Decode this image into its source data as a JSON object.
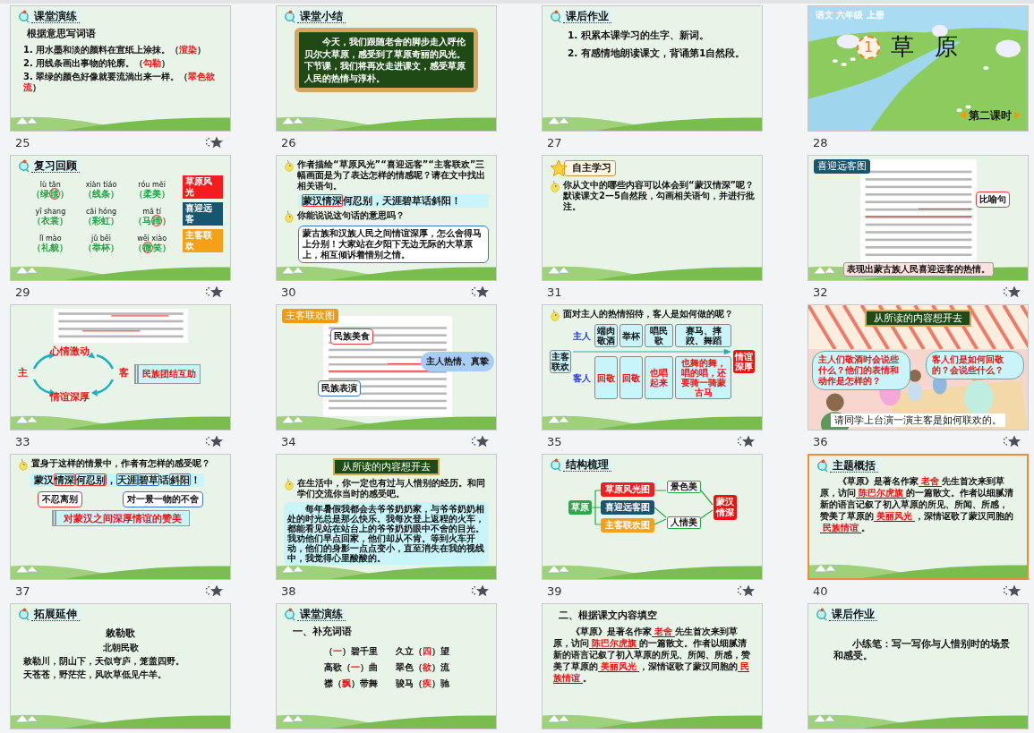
{
  "slides": [
    {
      "number": "25",
      "selected": false,
      "transition": true,
      "kind": "text",
      "blocks": [
        {
          "kind": "heading",
          "text": "课堂演练"
        },
        {
          "kind": "subtitle",
          "text": "根据意思写词语"
        },
        {
          "kind": "line",
          "segments": [
            {
              "text": "1. 用水墨和淡的颜料在宣纸上涂抹。（",
              "answer": false
            },
            {
              "text": "渲染",
              "answer": true
            },
            {
              "text": "）",
              "answer": false
            }
          ]
        },
        {
          "kind": "line",
          "segments": [
            {
              "text": "2. 用线条画出事物的轮廓。（",
              "answer": false
            },
            {
              "text": "勾勒",
              "answer": true
            },
            {
              "text": "）",
              "answer": false
            }
          ]
        },
        {
          "kind": "line",
          "segments": [
            {
              "text": "3. 翠绿的颜色好像就要流淌出来一样。（",
              "answer": false
            },
            {
              "text": "翠色欲流",
              "answer": true
            },
            {
              "text": "）",
              "answer": false
            }
          ]
        }
      ]
    },
    {
      "number": "26",
      "selected": false,
      "transition": false,
      "kind": "text",
      "blocks": [
        {
          "kind": "heading",
          "text": "课堂小结"
        },
        {
          "kind": "board",
          "text": "今天，我们跟随老舍的脚步走入呼伦贝尔大草原，感受到了草原奇丽的风光。下节课，我们将再次走进课文，感受草原人民的热情与淳朴。"
        }
      ]
    },
    {
      "number": "27",
      "selected": false,
      "transition": false,
      "kind": "text",
      "blocks": [
        {
          "kind": "heading",
          "text": "课后作业"
        },
        {
          "kind": "item",
          "text": "1. 积累本课学习的生字、新词。"
        },
        {
          "kind": "item",
          "text": "2. 有感情地朗读课文，背诵第1自然段。"
        }
      ]
    },
    {
      "number": "28",
      "selected": false,
      "transition": false,
      "kind": "title",
      "course": "语文 六年级 上册",
      "lesson_number": "1",
      "title": "草原",
      "period": "第二课时"
    },
    {
      "number": "29",
      "selected": false,
      "transition": true,
      "kind": "pinyin",
      "heading": "复习回顾",
      "rows": [
        {
          "cells": [
            {
              "pinyin": "lù tǎn",
              "word": [
                {
                  "text": "（绿",
                  "circled": false
                },
                {
                  "text": "毯",
                  "circled": true
                },
                {
                  "text": "）",
                  "circled": false
                }
              ]
            },
            {
              "pinyin": "xiàn tiáo",
              "word": [
                {
                  "text": "（线条）",
                  "circled": false
                }
              ]
            },
            {
              "pinyin": "róu měi",
              "word": [
                {
                  "text": "（柔美）",
                  "circled": false
                }
              ]
            }
          ],
          "tag": {
            "text": "草原风光",
            "color": "#f41c1c"
          }
        },
        {
          "cells": [
            {
              "pinyin": "yī shang",
              "word": [
                {
                  "text": "（衣裳）",
                  "circled": false
                }
              ]
            },
            {
              "pinyin": "cǎi hóng",
              "word": [
                {
                  "text": "（彩虹）",
                  "circled": false
                }
              ]
            },
            {
              "pinyin": "mǎ tí",
              "word": [
                {
                  "text": "（马",
                  "circled": false
                },
                {
                  "text": "蹄",
                  "circled": true
                },
                {
                  "text": "）",
                  "circled": false
                }
              ]
            }
          ],
          "tag": {
            "text": "喜迎远客",
            "color": "#17566e"
          }
        },
        {
          "cells": [
            {
              "pinyin": "lǐ mào",
              "word": [
                {
                  "text": "（礼貌）",
                  "circled": false
                }
              ]
            },
            {
              "pinyin": "jǔ bēi",
              "word": [
                {
                  "text": "（举杯）",
                  "circled": false
                }
              ]
            },
            {
              "pinyin": "wēi xiào",
              "word": [
                {
                  "text": "（",
                  "circled": false
                },
                {
                  "text": "微",
                  "circled": true
                },
                {
                  "text": "笑）",
                  "circled": false
                }
              ]
            }
          ],
          "tag": {
            "text": "主客联欢",
            "color": "#f6a019"
          }
        }
      ]
    },
    {
      "number": "30",
      "selected": false,
      "transition": true,
      "kind": "text",
      "blocks": [
        {
          "kind": "prompt",
          "text": "作者描绘“草原风光”“喜迎远客”“主客联欢”三幅画面是为了表达怎样的情感呢？请在文中找出相关语句。"
        },
        {
          "kind": "quote",
          "segments": [
            {
              "text": "蒙汉情深",
              "boxed": true
            },
            {
              "text": "何忍别，天涯碧草话斜阳！",
              "boxed": false
            }
          ]
        },
        {
          "kind": "prompt",
          "text": "你能说说这句话的意思吗？"
        },
        {
          "kind": "explanation",
          "text": "蒙古族和汉族人民之间情谊深厚，怎么舍得马上分别！大家站在夕阳下无边无际的大草原上，相互倾诉着惜别之情。"
        }
      ]
    },
    {
      "number": "31",
      "selected": false,
      "transition": false,
      "kind": "text",
      "blocks": [
        {
          "kind": "badge",
          "text": "自主学习"
        },
        {
          "kind": "prompt",
          "text": "你从文中的哪些内容可以体会到“蒙汉情深”呢？默读课文2—5自然段，勾画相关语句，并进行批注。"
        }
      ]
    },
    {
      "number": "32",
      "selected": false,
      "transition": true,
      "kind": "annotated",
      "tag": {
        "text": "喜迎远客图",
        "color": "#17566e"
      },
      "callouts": [
        {
          "text": "比喻句",
          "color": "#e53935"
        }
      ],
      "caption": "表现出蒙古族人民喜迎远客的热情。"
    },
    {
      "number": "33",
      "selected": false,
      "transition": true,
      "kind": "cycle",
      "cycle": {
        "top": "心情激动",
        "left": "主",
        "right": "客",
        "bottom": "情谊深厚"
      },
      "scroll": "民族团结互助"
    },
    {
      "number": "34",
      "selected": false,
      "transition": true,
      "kind": "annotated",
      "tag": {
        "text": "主客联欢图",
        "color": "#f39a12"
      },
      "callouts": [
        {
          "text": "民族美食",
          "color": "#e53935"
        },
        {
          "text": "民族表演",
          "color": "#3a78c2"
        }
      ],
      "cloud": "主人热情、真挚"
    },
    {
      "number": "35",
      "selected": false,
      "transition": true,
      "kind": "fishbone",
      "prompt": "面对主人的热情招待，客人是如何做的呢？",
      "start": "主客联欢",
      "end": "情谊深厚",
      "rows": [
        {
          "label": "主人",
          "items": [
            "端肉敬酒",
            "举杯",
            "唱民歌",
            "赛马、摔跤、舞蹈"
          ]
        },
        {
          "label": "客人",
          "items": [
            "回敬",
            "回敬",
            "也唱起来",
            "也舞的舞，唱的唱，还要骑一骑蒙古马"
          ]
        }
      ]
    },
    {
      "number": "36",
      "selected": false,
      "transition": true,
      "kind": "scene",
      "banner": "从所读的内容想开去",
      "clouds": [
        "主人们敬酒时会说些什么？他们的表情和动作是怎样的？",
        "客人们是如何回敬的？会说些什么？"
      ],
      "caption": "请同学上台演一演主客是如何联欢的。"
    },
    {
      "number": "37",
      "selected": false,
      "transition": true,
      "kind": "analysis",
      "prompt": "置身于这样的情景中，作者有怎样的感受呢？",
      "sentence": [
        {
          "text": "蒙汉"
        },
        {
          "text": "情深",
          "color": "#e53935"
        },
        {
          "text": "何忍别",
          "color": "#e53935"
        },
        {
          "text": "，"
        },
        {
          "text": "天涯",
          "color": "#3a78c2"
        },
        {
          "text": "碧草",
          "color": "#3a78c2"
        },
        {
          "text": "话"
        },
        {
          "text": "斜阳",
          "color": "#3a78c2"
        },
        {
          "text": "！"
        }
      ],
      "callouts": [
        {
          "text": "不忍离别",
          "color": "#e53935"
        },
        {
          "text": "对一景一物的不舍",
          "color": "#3a78c2"
        }
      ],
      "scroll": "对蒙汉之间深厚情谊的赞美"
    },
    {
      "number": "38",
      "selected": false,
      "transition": true,
      "kind": "text",
      "blocks": [
        {
          "kind": "banner",
          "text": "从所读的内容想开去"
        },
        {
          "kind": "prompt",
          "text": "在生活中，你一定也有过与人惜别的经历。和同学们交流你当时的感受吧。"
        },
        {
          "kind": "story",
          "text": "每年暑假我都会去爷爷奶奶家，与爷爷奶奶相处的时光总是那么快乐。我每次登上返程的火车，都能看见站在站台上的爷爷奶奶眼中不舍的目光。我劝他们早点回家，他们却从不肯。等到火车开动，他们的身影一点点变小，直至消失在我的视线中，我觉得心里酸酸的。"
        }
      ]
    },
    {
      "number": "39",
      "selected": false,
      "transition": true,
      "kind": "structure",
      "heading": "结构梳理",
      "root": "草原",
      "branches": [
        {
          "text": "草原风光图",
          "color": "#f41c1c"
        },
        {
          "text": "喜迎远客图",
          "color": "#17566e"
        },
        {
          "text": "主客联欢图",
          "color": "#f6a019"
        }
      ],
      "results": [
        "景色美",
        "人情美"
      ],
      "end": "蒙汉情深"
    },
    {
      "number": "40",
      "selected": true,
      "transition": true,
      "kind": "text",
      "blocks": [
        {
          "kind": "heading",
          "text": "主题概括"
        },
        {
          "kind": "fill",
          "segments": [
            {
              "text": "《草原》是著名作家",
              "answer": false
            },
            {
              "text": "老舍",
              "answer": true
            },
            {
              "text": "先生首次来到草原，访问",
              "answer": false
            },
            {
              "text": "陈巴尔虎旗",
              "answer": true
            },
            {
              "text": "的一篇散文。作者以细腻清新的语言记叙了初入草原的所见、所闻、所感，赞美了草原的",
              "answer": false
            },
            {
              "text": "美丽风光",
              "answer": true
            },
            {
              "text": "，深情讴歌了蒙汉同胞的",
              "answer": false
            },
            {
              "text": "民族情谊",
              "answer": true
            },
            {
              "text": "。",
              "answer": false
            }
          ]
        }
      ]
    },
    {
      "selected": false,
      "kind": "text",
      "blocks": [
        {
          "kind": "heading",
          "text": "拓展延伸"
        },
        {
          "kind": "poem-title",
          "text": "敕勒歌"
        },
        {
          "kind": "poem-author",
          "text": "北朝民歌"
        },
        {
          "kind": "verse",
          "text": "敕勒川，阴山下，天似穹庐，笼盖四野。"
        },
        {
          "kind": "verse",
          "text": "天苍苍，野茫茫，风吹草低见牛羊。"
        }
      ]
    },
    {
      "selected": false,
      "kind": "text",
      "blocks": [
        {
          "kind": "heading",
          "text": "课堂演练"
        },
        {
          "kind": "subtitle",
          "text": "一、补充词语"
        },
        {
          "kind": "grid",
          "cells": [
            [
              {
                "text": "（",
                "answer": false
              },
              {
                "text": "一",
                "answer": true
              },
              {
                "text": "）碧千里",
                "answer": false
              }
            ],
            [
              {
                "text": "久立（",
                "answer": false
              },
              {
                "text": "四",
                "answer": true
              },
              {
                "text": "）望",
                "answer": false
              }
            ],
            [
              {
                "text": "高歌（",
                "answer": false
              },
              {
                "text": "一",
                "answer": true
              },
              {
                "text": "）曲",
                "answer": false
              }
            ],
            [
              {
                "text": "翠色（",
                "answer": false
              },
              {
                "text": "欲",
                "answer": true
              },
              {
                "text": "）流",
                "answer": false
              }
            ],
            [
              {
                "text": "襟（",
                "answer": false
              },
              {
                "text": "飘",
                "answer": true
              },
              {
                "text": "）带舞",
                "answer": false
              }
            ],
            [
              {
                "text": "骏马（",
                "answer": false
              },
              {
                "text": "疾",
                "answer": true
              },
              {
                "text": "）驰",
                "answer": false
              }
            ]
          ]
        }
      ]
    },
    {
      "selected": false,
      "kind": "text",
      "blocks": [
        {
          "kind": "subtitle",
          "text": "二、根据课文内容填空"
        },
        {
          "kind": "fill",
          "segments": [
            {
              "text": "《草原》是著名作家",
              "answer": false
            },
            {
              "text": "老舍",
              "answer": true
            },
            {
              "text": "先生首次来到草原，访问",
              "answer": false
            },
            {
              "text": "陈巴尔虎旗",
              "answer": true
            },
            {
              "text": "的一篇散文。作者以细腻清新的语言记叙了初入草原的所见、所闻、所感，赞美了草原的",
              "answer": false
            },
            {
              "text": "美丽风光",
              "answer": true
            },
            {
              "text": "，深情讴歌了蒙汉同胞的",
              "answer": false
            },
            {
              "text": "民族情谊",
              "answer": true
            },
            {
              "text": "。",
              "answer": false
            }
          ]
        }
      ]
    },
    {
      "selected": false,
      "kind": "text",
      "blocks": [
        {
          "kind": "heading",
          "text": "课后作业"
        },
        {
          "kind": "story-plain",
          "text": "小练笔：写一写你与人惜别时的场景和感受。"
        }
      ]
    }
  ]
}
